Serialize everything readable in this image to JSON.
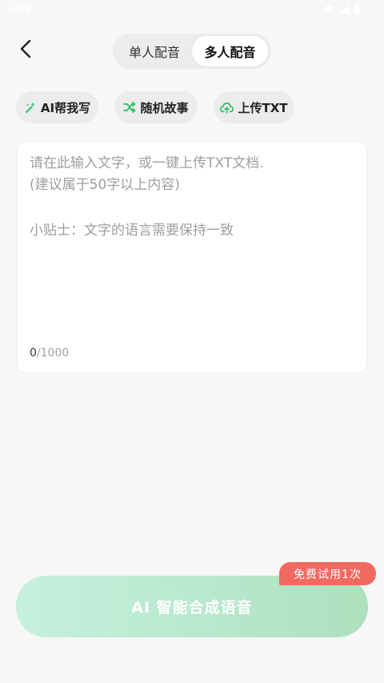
{
  "status_bar": {
    "time": "4:58"
  },
  "header": {
    "tabs": [
      {
        "label": "单人配音",
        "selected": false
      },
      {
        "label": "多人配音",
        "selected": true
      }
    ]
  },
  "actions": {
    "ai_write": "AI帮我写",
    "random_story": "随机故事",
    "upload_txt": "上传TXT"
  },
  "editor": {
    "placeholder_line1": "请在此输入文字，或一键上传TXT文档.",
    "placeholder_line2": "(建议属于50字以上内容)",
    "tip": "小贴士：文字的语言需要保持一致",
    "count": "0",
    "max": "/1000"
  },
  "footer": {
    "synthesize_label": "AI 智能合成语音",
    "free_badge": "免费试用1次"
  },
  "colors": {
    "accent_green": "#2fbf6a",
    "badge_red": "#f16a62",
    "button_gradient_start": "#c5f0dd",
    "button_gradient_end": "#aee0bd"
  }
}
